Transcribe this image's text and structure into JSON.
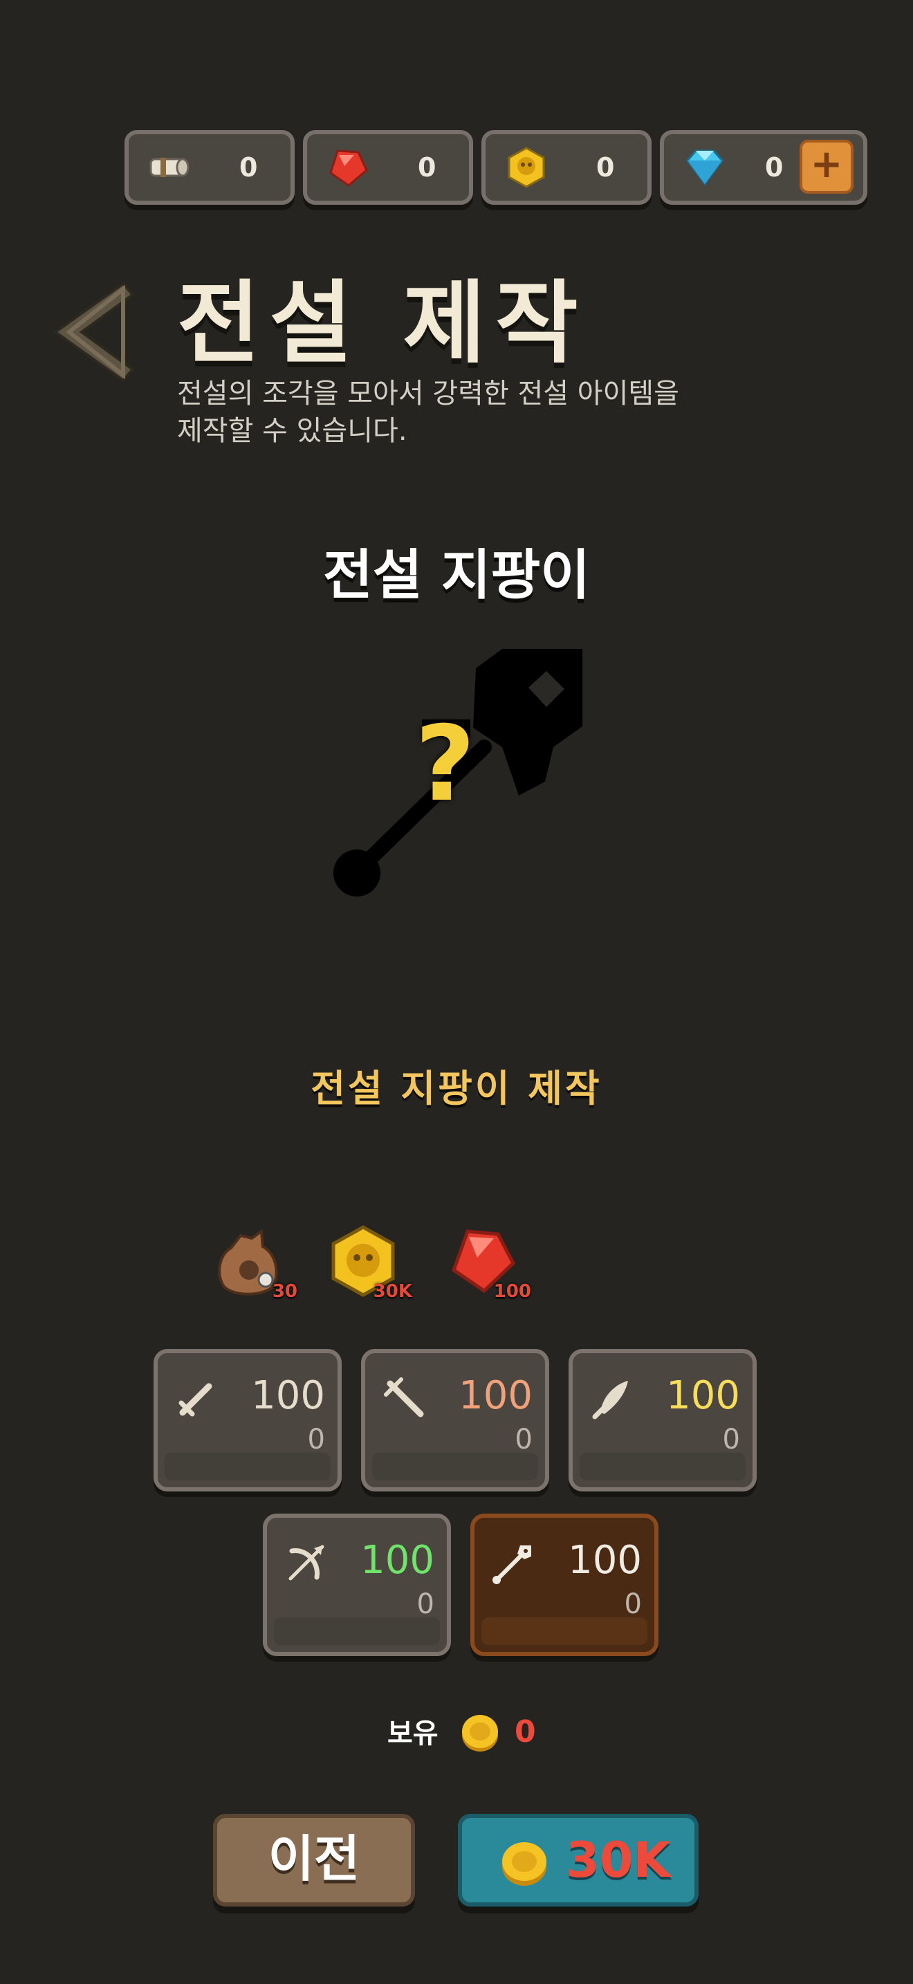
{
  "currencies": [
    {
      "name": "scroll",
      "value": "0"
    },
    {
      "name": "red-gem",
      "value": "0"
    },
    {
      "name": "skull-coin",
      "value": "0"
    },
    {
      "name": "diamond",
      "value": "0"
    }
  ],
  "header": {
    "title": "전설 제작",
    "subtitle": "전설의 조각을 모아서 강력한 전설 아이템을 제작할 수 있습니다."
  },
  "item": {
    "name": "전설 지팡이",
    "mystery_mark": "?",
    "craft_label": "전설 지팡이 제작"
  },
  "materials": [
    {
      "icon": "bag-icon",
      "amount": "30"
    },
    {
      "icon": "skull-coin-icon",
      "amount": "30K"
    },
    {
      "icon": "red-gem-icon",
      "amount": "100"
    }
  ],
  "classes": [
    {
      "icon": "sword-icon",
      "need": "100",
      "have": "0",
      "color": "#e6dccb"
    },
    {
      "icon": "crossed-swords-icon",
      "need": "100",
      "have": "0",
      "color": "#f2a27a"
    },
    {
      "icon": "dagger-icon",
      "need": "100",
      "have": "0",
      "color": "#f6dd5a"
    },
    {
      "icon": "bow-icon",
      "need": "100",
      "have": "0",
      "color": "#6fe36a"
    },
    {
      "icon": "staff-icon",
      "need": "100",
      "have": "0",
      "color": "#f0ece4"
    }
  ],
  "owned": {
    "label": "보유",
    "value": "0"
  },
  "buttons": {
    "prev": "이전",
    "craft_cost": "30K"
  },
  "colors": {
    "background": "#252420",
    "accent_gold": "#f4c75e",
    "cost_red": "#ee4a3c",
    "craft_button": "#2a8a9a"
  }
}
